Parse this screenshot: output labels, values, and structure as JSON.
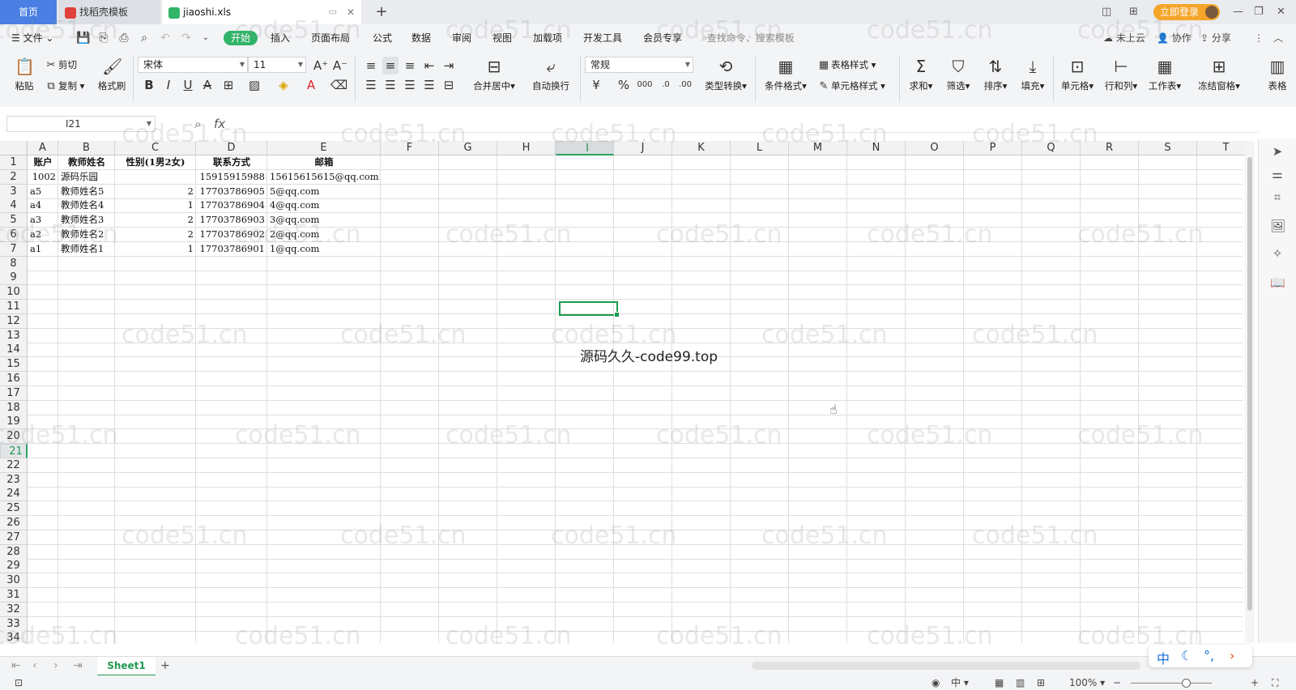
{
  "titlebar": {
    "tabs": [
      {
        "label": "首页"
      },
      {
        "label": "找稻壳模板"
      },
      {
        "label": "jiaoshi.xls"
      }
    ],
    "login_label": "立即登录"
  },
  "menu": {
    "file_label": "文件",
    "items": [
      "开始",
      "插入",
      "页面布局",
      "公式",
      "数据",
      "审阅",
      "视图",
      "加载项",
      "开发工具",
      "会员专享"
    ],
    "search_placeholder": "查找命令、搜索模板",
    "cloud_label": "未上云",
    "collab_label": "协作",
    "share_label": "分享"
  },
  "ribbon": {
    "paste": "粘贴",
    "cut": "剪切",
    "copy": "复制",
    "format_painter": "格式刷",
    "font_name": "宋体",
    "font_size": "11",
    "merge_center": "合并居中",
    "wrap_text": "自动换行",
    "number_format": "常规",
    "type_convert": "类型转换",
    "cond_format": "条件格式",
    "table_style": "表格样式",
    "cell_style": "单元格样式",
    "sum": "求和",
    "filter": "筛选",
    "sort": "排序",
    "fill": "填充",
    "cell": "单元格",
    "row_col": "行和列",
    "worksheet": "工作表",
    "freeze": "冻结窗格",
    "table_tools": "表格"
  },
  "formula_bar": {
    "name_box": "I21",
    "fx_label": "fx",
    "formula": ""
  },
  "sheet": {
    "columns": [
      "A",
      "B",
      "C",
      "D",
      "E",
      "F",
      "G",
      "H",
      "I",
      "J",
      "K",
      "L",
      "M",
      "N",
      "O",
      "P",
      "Q",
      "R",
      "S",
      "T"
    ],
    "selected_column": "I",
    "selected_row": 21,
    "header_row": [
      "账户",
      "教师姓名",
      "性别(1男2女)",
      "联系方式",
      "邮箱"
    ],
    "rows": [
      [
        "1002",
        "源码乐园",
        "",
        "15915915988",
        "15615615615@qq.com"
      ],
      [
        "a5",
        "教师姓名5",
        "2",
        "17703786905",
        "5@qq.com"
      ],
      [
        "a4",
        "教师姓名4",
        "1",
        "17703786904",
        "4@qq.com"
      ],
      [
        "a3",
        "教师姓名3",
        "2",
        "17703786903",
        "3@qq.com"
      ],
      [
        "a2",
        "教师姓名2",
        "2",
        "17703786902",
        "2@qq.com"
      ],
      [
        "a1",
        "教师姓名1",
        "1",
        "17703786901",
        "1@qq.com"
      ]
    ],
    "row_count": 34,
    "overlay_text": "源码久久-code99.top",
    "watermark": "code51.cn"
  },
  "sheet_tabs": {
    "active": "Sheet1",
    "add_label": "+"
  },
  "ime": {
    "lang": "中"
  },
  "statusbar": {
    "input_mode": "中",
    "zoom": "100%"
  }
}
